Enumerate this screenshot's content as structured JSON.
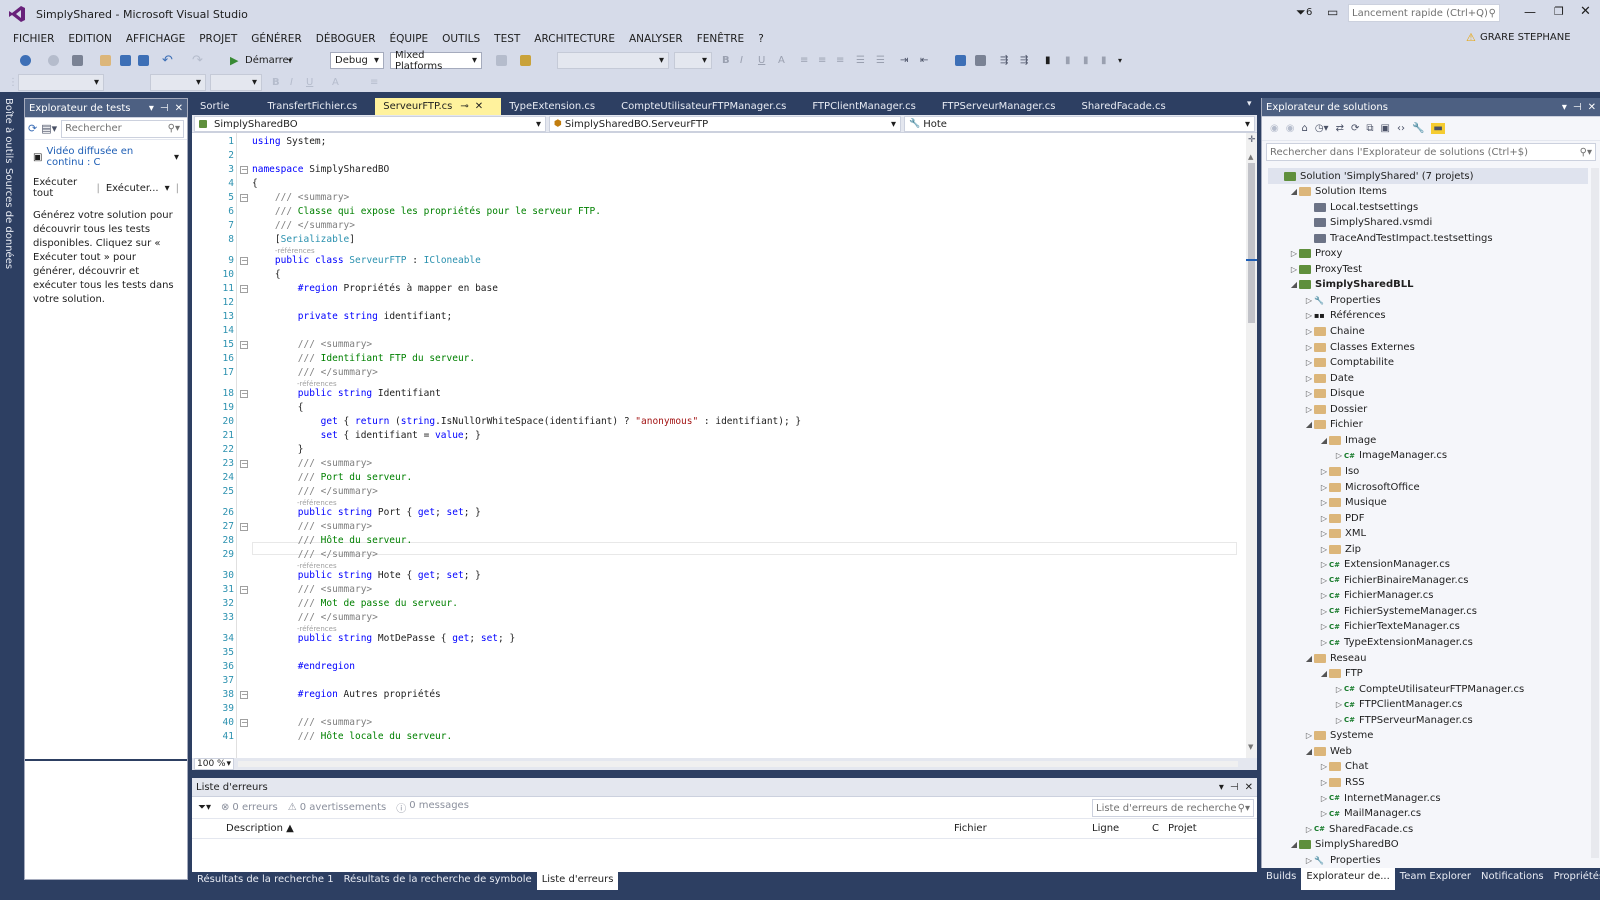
{
  "window": {
    "title": "SimplyShared - Microsoft Visual Studio",
    "quick_launch_placeholder": "Lancement rapide (Ctrl+Q)",
    "notif_count": "6",
    "user": "GRARE STEPHANE"
  },
  "menu": [
    "FICHIER",
    "EDITION",
    "AFFICHAGE",
    "PROJET",
    "GÉNÉRER",
    "DÉBOGUER",
    "ÉQUIPE",
    "OUTILS",
    "TEST",
    "ARCHITECTURE",
    "ANALYSER",
    "FENÊTRE",
    "?"
  ],
  "toolbar": {
    "start_label": "Démarrer",
    "config": "Debug",
    "platform": "Mixed Platforms"
  },
  "sidetabs": [
    "Boîte à outils",
    "Sources de données"
  ],
  "test_explorer": {
    "title": "Explorateur de tests",
    "search_placeholder": "Rechercher",
    "video": "Vidéo diffusée en continu : C",
    "run_all": "Exécuter tout",
    "run": "Exécuter...",
    "message": "Générez votre solution pour découvrir tous les tests disponibles. Cliquez sur « Exécuter tout » pour générer, découvrir et exécuter tous les tests dans votre solution."
  },
  "doc_tabs": [
    "Sortie",
    "TransfertFichier.cs",
    "ServeurFTP.cs",
    "TypeExtension.cs",
    "CompteUtilisateurFTPManager.cs",
    "FTPClientManager.cs",
    "FTPServeurManager.cs",
    "SharedFacade.cs"
  ],
  "active_tab": "ServeurFTP.cs",
  "nav": {
    "project": "SimplySharedBO",
    "type": "SimplySharedBO.ServeurFTP",
    "member": "Hote"
  },
  "refs_label": "-références",
  "zoom": "100 %",
  "error_list": {
    "title": "Liste d'erreurs",
    "errors": "0 erreurs",
    "warnings": "0 avertissements",
    "messages": "0 messages",
    "search_placeholder": "Liste d'erreurs de recherche",
    "columns": [
      "Description",
      "Fichier",
      "Ligne",
      "C",
      "Projet"
    ]
  },
  "bottom_tabs": [
    "Résultats de la recherche 1",
    "Résultats de la recherche de symbole",
    "Liste d'erreurs"
  ],
  "solution_explorer": {
    "title": "Explorateur de solutions",
    "search_placeholder": "Rechercher dans l'Explorateur de solutions (Ctrl+$)"
  },
  "right_bottom_tabs": [
    "Builds",
    "Explorateur de...",
    "Team Explorer",
    "Notifications",
    "Propriétés"
  ]
}
